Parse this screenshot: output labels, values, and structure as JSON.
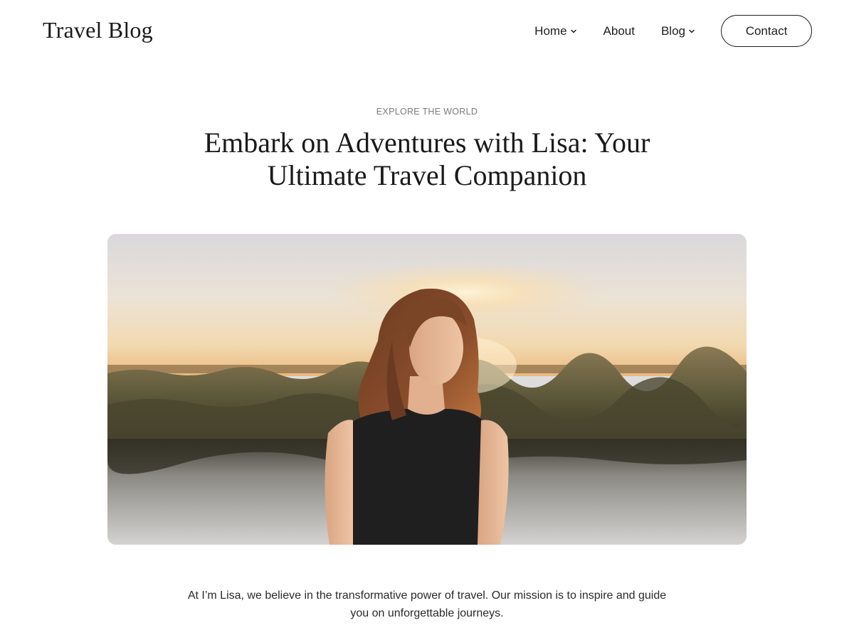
{
  "header": {
    "site_title": "Travel Blog",
    "nav": [
      {
        "label": "Home",
        "has_dropdown": true
      },
      {
        "label": "About",
        "has_dropdown": false
      },
      {
        "label": "Blog",
        "has_dropdown": true
      }
    ],
    "cta_label": "Contact"
  },
  "hero": {
    "eyebrow": "EXPLORE THE WORLD",
    "headline_line1": "Embark on Adventures with Lisa: Your",
    "headline_line2": "Ultimate Travel Companion",
    "image_subject": "woman in black top at sunset beside lake",
    "intro_line1": "At I’m Lisa, we believe in the transformative power of travel. Our mission is to inspire and guide",
    "intro_line2": "you on unforgettable journeys."
  },
  "colors": {
    "text": "#1a1a1a",
    "muted": "#7c7c7c",
    "background": "#ffffff"
  },
  "icons": {
    "dropdown": "chevron-down-icon"
  }
}
